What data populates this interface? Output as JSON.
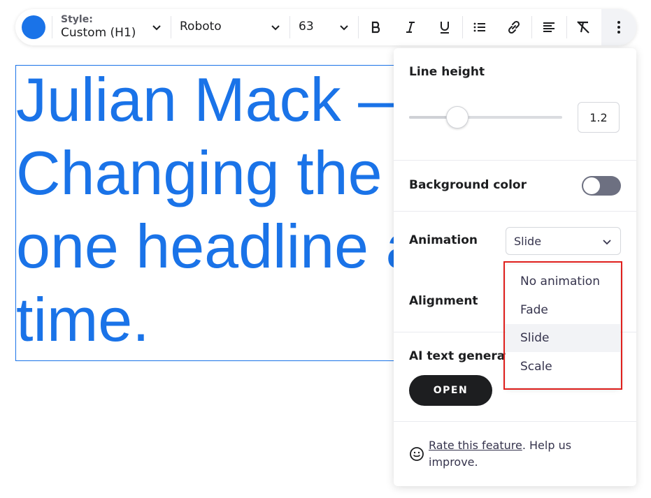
{
  "toolbar": {
    "color_swatch": "#1a73e8",
    "style_label": "Style:",
    "style_value": "Custom (H1)",
    "font_value": "Roboto",
    "size_value": "63",
    "icons": [
      "bold-icon",
      "italic-icon",
      "underline-icon",
      "list-icon",
      "link-icon",
      "align-left-icon",
      "clear-format-icon",
      "more-vertical-icon"
    ]
  },
  "headline": {
    "text": "Julian Mack —\nChanging the world\none headline at a\ntime.",
    "color": "#1a73e8"
  },
  "panel": {
    "line_height_label": "Line height",
    "line_height_value": "1.2",
    "line_height_slider_fraction": 0.31,
    "background_color_label": "Background color",
    "background_color_enabled": false,
    "animation_label": "Animation",
    "animation_value": "Slide",
    "alignment_label": "Alignment",
    "ai_label": "AI text generator",
    "open_button": "OPEN",
    "rate_link": "Rate this feature",
    "rate_suffix": ". Help us improve."
  },
  "dropdown": {
    "options": [
      "No animation",
      "Fade",
      "Slide",
      "Scale"
    ],
    "selected": "Slide",
    "highlight_color": "#e0201d"
  }
}
